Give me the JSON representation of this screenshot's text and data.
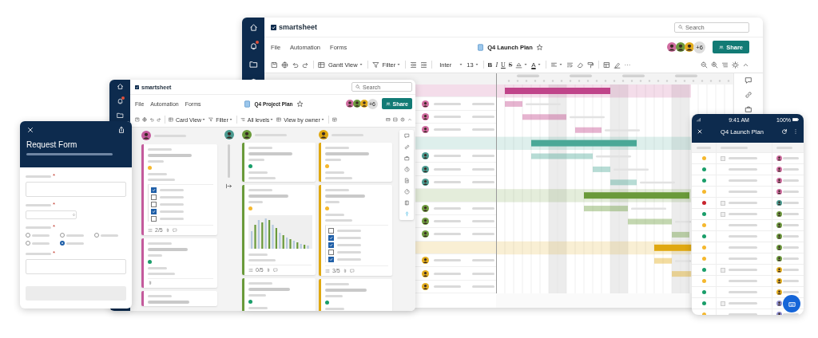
{
  "launch_plan_window": {
    "logo": "smartsheet",
    "search_placeholder": "Search",
    "menu": [
      "File",
      "Automation",
      "Forms"
    ],
    "title": "Q4 Launch Plan",
    "extra_collaborators": "+6",
    "share_button": "Share",
    "toolbar": {
      "view": "Gantt View",
      "filter": "Filter",
      "font": "Inter",
      "font_size": "13",
      "format": [
        "B",
        "I",
        "U",
        "S"
      ],
      "font_color": "A"
    },
    "phases": [
      {
        "color": "#c0448a"
      },
      {
        "color": "#4aa897"
      },
      {
        "color": "#6a9a3a"
      },
      {
        "color": "#e0a810"
      }
    ]
  },
  "project_plan_window": {
    "logo": "smartsheet",
    "search_placeholder": "Search",
    "menu": [
      "File",
      "Automation",
      "Forms"
    ],
    "title": "Q4 Project Plan",
    "extra_collaborators": "+6",
    "share_button": "Share",
    "toolbar": {
      "view": "Card View",
      "filter": "Filter",
      "levels": "All levels",
      "grouping": "View by owner"
    },
    "lanes": [
      {
        "kind": "cards",
        "color": "#c45a9c",
        "cards": [
          {
            "kind": "task",
            "color": "#f5b82e",
            "checklist": [
              {
                "checked": true
              },
              {
                "checked": false
              },
              {
                "checked": false
              },
              {
                "checked": true
              },
              {
                "checked": false
              }
            ],
            "count": "2/5"
          },
          {
            "kind": "task",
            "color": "#1a9e6a",
            "attachment": true
          },
          {
            "kind": "stub"
          }
        ]
      },
      {
        "kind": "collapsed",
        "color": "#4a9a90"
      },
      {
        "kind": "cards",
        "color": "#6a9a3a",
        "cards": [
          {
            "kind": "task",
            "color": "#1a9e6a"
          },
          {
            "kind": "chart",
            "color": "#f5b82e",
            "count": "0/5"
          },
          {
            "kind": "task",
            "color": "#1a9e6a"
          }
        ]
      },
      {
        "kind": "cards",
        "color": "#e0a810",
        "cards": [
          {
            "kind": "task",
            "color": "#f5b82e"
          },
          {
            "kind": "task",
            "color": "#f5b82e",
            "checklist": [
              {
                "checked": false
              },
              {
                "checked": true
              },
              {
                "checked": true
              },
              {
                "checked": false
              },
              {
                "checked": true
              }
            ],
            "count": "3/5"
          },
          {
            "kind": "task",
            "color": "#1a9e6a"
          }
        ]
      }
    ]
  },
  "request_form": {
    "title": "Request Form",
    "fields": [
      {
        "kind": "text",
        "required_mark": "*"
      },
      {
        "kind": "select",
        "required_mark": "*"
      },
      {
        "kind": "radio",
        "required_mark": "*",
        "options": [
          {
            "selected": false
          },
          {
            "selected": false
          },
          {
            "selected": false
          },
          {
            "selected": false
          },
          {
            "selected": true
          }
        ]
      },
      {
        "kind": "text",
        "required_mark": "*"
      }
    ]
  },
  "mobile_app": {
    "time": "9:41 AM",
    "battery": "100%",
    "title": "Q4 Launch Plan",
    "rows": [
      {
        "color": "#f5b82e",
        "expandable": true
      },
      {
        "color": "#1a9e6a",
        "expandable": false
      },
      {
        "color": "#1a9e6a",
        "expandable": false
      },
      {
        "color": "#f5b82e",
        "expandable": false
      },
      {
        "color": "#c8242e",
        "expandable": true
      },
      {
        "color": "#1a9e6a",
        "expandable": true
      },
      {
        "color": "#f5b82e",
        "expandable": false
      },
      {
        "color": "#1a9e6a",
        "expandable": false
      },
      {
        "color": "#f5b82e",
        "expandable": false
      },
      {
        "color": "#f5b82e",
        "expandable": false
      },
      {
        "color": "#1a9e6a",
        "expandable": true
      },
      {
        "color": "#f5b82e",
        "expandable": false
      },
      {
        "color": "#1a9e6a",
        "expandable": false
      },
      {
        "color": "#1a9e6a",
        "expandable": true
      },
      {
        "color": "#f5b82e",
        "expandable": false
      }
    ]
  }
}
